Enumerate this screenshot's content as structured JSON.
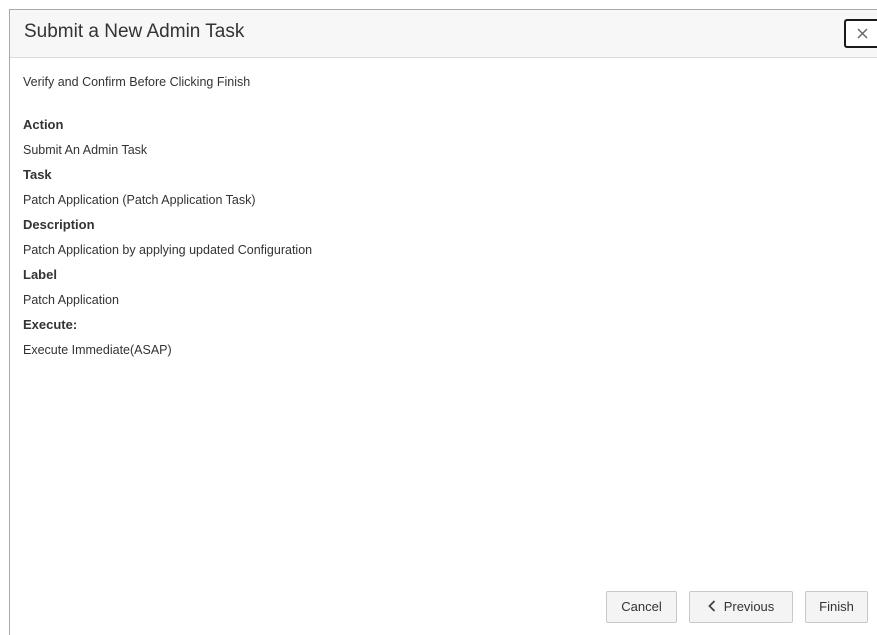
{
  "dialog": {
    "title": "Submit a New Admin Task",
    "close_icon": "close-icon"
  },
  "body": {
    "instruction": "Verify and Confirm Before Clicking Finish",
    "details": [
      {
        "label": "Action",
        "value": "Submit An Admin Task"
      },
      {
        "label": "Task",
        "value": "Patch Application (Patch Application Task)"
      },
      {
        "label": "Description",
        "value": "Patch Application by applying updated Configuration"
      },
      {
        "label": "Label",
        "value": "Patch Application"
      },
      {
        "label": "Execute:",
        "value": "Execute Immediate(ASAP)"
      }
    ]
  },
  "footer": {
    "cancel_label": "Cancel",
    "previous_label": "Previous",
    "previous_icon": "chevron-left-icon",
    "finish_label": "Finish"
  },
  "colors": {
    "header_bg": "#f7f7f7",
    "button_bg": "#f4f4f4",
    "text": "#333333"
  }
}
